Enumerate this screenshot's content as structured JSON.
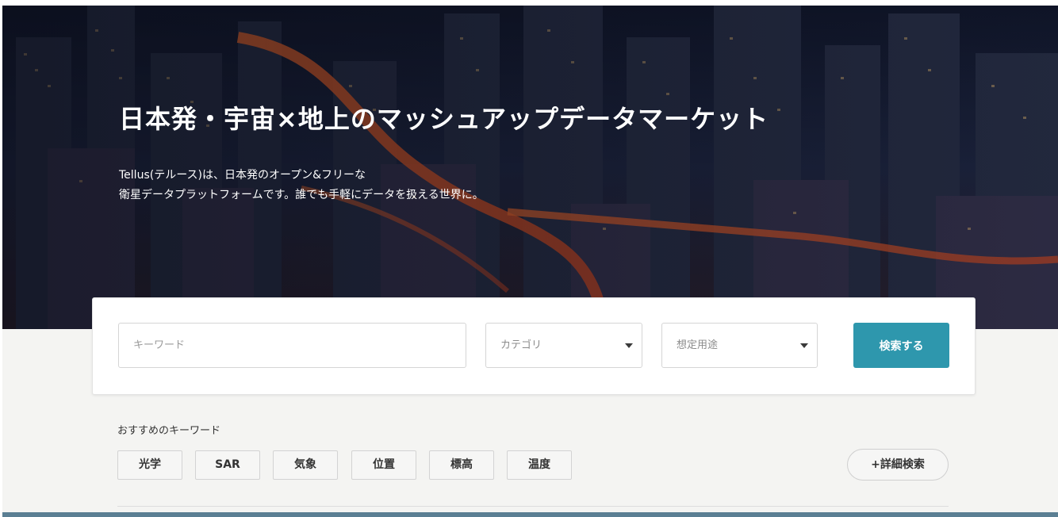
{
  "hero": {
    "title": "日本発・宇宙×地上のマッシュアップデータマーケット",
    "description_lines": [
      "Tellus(テルース)は、日本発のオープン&フリーな",
      "衛星データプラットフォームです。誰でも手軽にデータを扱える世界に。"
    ]
  },
  "search": {
    "keyword_placeholder": "キーワード",
    "keyword_value": "",
    "category_label": "カテゴリ",
    "usage_label": "想定用途",
    "submit_label": "検索する"
  },
  "recommended": {
    "label": "おすすめのキーワード",
    "tags": [
      "光学",
      "SAR",
      "気象",
      "位置",
      "標高",
      "温度"
    ],
    "advanced_label": "+詳細検索"
  },
  "colors": {
    "accent": "#2e97ad",
    "hero_overlay": "#141a2c",
    "city_glow": "#e0622a"
  },
  "icons": {
    "select_caret": "chevron-down-icon"
  }
}
